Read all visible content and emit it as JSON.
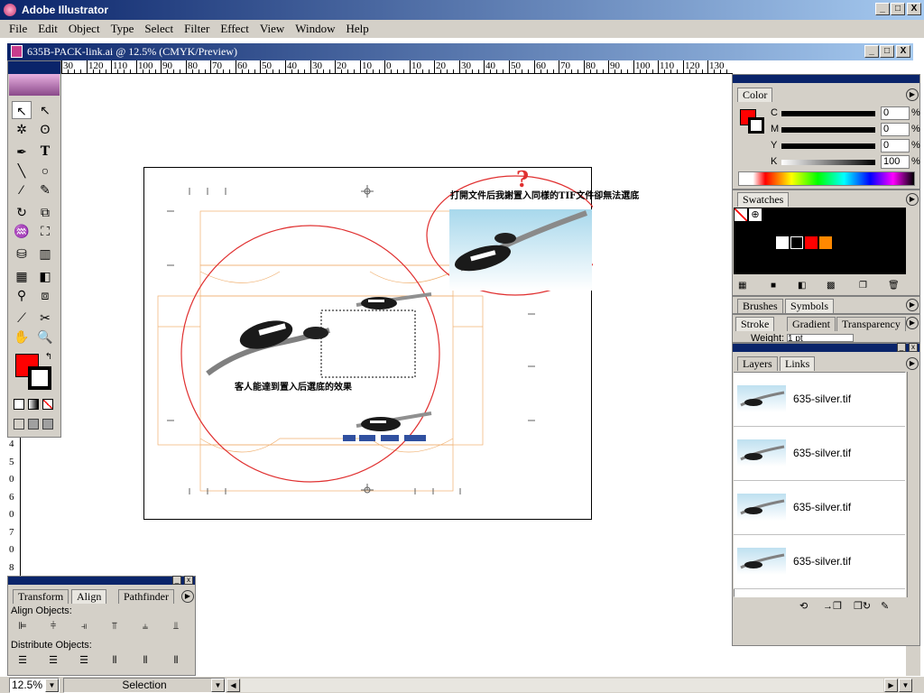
{
  "app": {
    "title": "Adobe Illustrator",
    "minimize": "_",
    "maximize": "□",
    "close": "X"
  },
  "menu": [
    "File",
    "Edit",
    "Object",
    "Type",
    "Select",
    "Filter",
    "Effect",
    "View",
    "Window",
    "Help"
  ],
  "document": {
    "title": "635B-PACK-link.ai @ 12.5% (CMYK/Preview)"
  },
  "ruler_h_labels": [
    "30",
    "120",
    "110",
    "100",
    "90",
    "80",
    "70",
    "60",
    "50",
    "40",
    "30",
    "20",
    "10",
    "0",
    "10",
    "20",
    "30",
    "40",
    "50",
    "60",
    "70",
    "80",
    "90",
    "100",
    "110",
    "120",
    "130"
  ],
  "ruler_v_labels": [
    "4",
    "5",
    "0",
    "6",
    "0",
    "7",
    "0",
    "8"
  ],
  "artwork": {
    "annotation_top": "打開文件后我謝置入同樣的TIF文件卻無法選底",
    "annotation_left": "客人能達到置入后選底的效果",
    "question_mark": "?"
  },
  "color_panel": {
    "tab": "Color",
    "labels": [
      "C",
      "M",
      "Y",
      "K"
    ],
    "values": [
      "0",
      "0",
      "0",
      "100"
    ],
    "percent": "%",
    "fill_color": "#ff0000"
  },
  "swatches_panel": {
    "tab": "Swatches"
  },
  "brushes_panel": {
    "tabs": [
      "Brushes",
      "Symbols"
    ]
  },
  "stroke_panel": {
    "tabs": [
      "Stroke",
      "Gradient",
      "Transparency"
    ],
    "weight_label": "Weight:",
    "weight_value": "1 pt"
  },
  "links_panel": {
    "tabs": [
      "Layers",
      "Links"
    ],
    "items": [
      "635-silver.tif",
      "635-silver.tif",
      "635-silver.tif",
      "635-silver.tif"
    ]
  },
  "align_panel": {
    "tabs": [
      "Transform",
      "Align",
      "Pathfinder"
    ],
    "align_objects_label": "Align Objects:",
    "distribute_objects_label": "Distribute Objects:"
  },
  "status": {
    "zoom": "12.5%",
    "tool": "Selection"
  }
}
